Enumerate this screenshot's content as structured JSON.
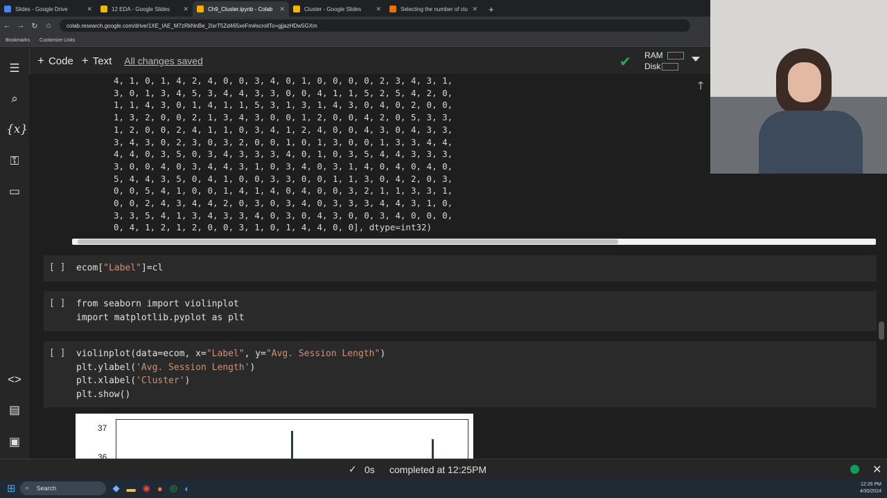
{
  "tabs": [
    {
      "title": "Slides - Google Drive",
      "color": "#4285f4"
    },
    {
      "title": "12 EDA - Google Slides",
      "color": "#f4b400"
    },
    {
      "title": "Ch9_Cluster.ipynb - Colab",
      "color": "#f9ab00"
    },
    {
      "title": "Cluster - Google Slides",
      "color": "#f4b400"
    },
    {
      "title": "Selecting the number of cluste...",
      "color": "#e8710a"
    }
  ],
  "address": {
    "url": "colab.research.google.com/drive/1XE_IAE_M7zRkNnBe_2isrT5Zd465xeFm#scrollTo=gjjazHDw5GXm"
  },
  "bookmarks": {
    "items": [
      "Bookmarks",
      "Customize Links"
    ]
  },
  "toolbar": {
    "code_label": "Code",
    "text_label": "Text",
    "status": "All changes saved",
    "ram_label": "RAM",
    "disk_label": "Disk"
  },
  "output_text": "4, 1, 0, 1, 4, 2, 4, 0, 0, 3, 4, 0, 1, 0, 0, 0, 0, 2, 3, 4, 3, 1,\n3, 0, 1, 3, 4, 5, 3, 4, 4, 3, 3, 0, 0, 4, 1, 1, 5, 2, 5, 4, 2, 0,\n1, 1, 4, 3, 0, 1, 4, 1, 1, 5, 3, 1, 3, 1, 4, 3, 0, 4, 0, 2, 0, 0,\n1, 3, 2, 0, 0, 2, 1, 3, 4, 3, 0, 0, 1, 2, 0, 0, 4, 2, 0, 5, 3, 3,\n1, 2, 0, 0, 2, 4, 1, 1, 0, 3, 4, 1, 2, 4, 0, 0, 4, 3, 0, 4, 3, 3,\n3, 4, 3, 0, 2, 3, 0, 3, 2, 0, 0, 1, 0, 1, 3, 0, 0, 1, 3, 3, 4, 4,\n4, 4, 0, 3, 5, 0, 3, 4, 3, 3, 3, 4, 0, 1, 0, 3, 5, 4, 4, 3, 3, 3,\n3, 0, 0, 4, 0, 3, 4, 4, 3, 1, 0, 3, 4, 0, 3, 1, 4, 0, 4, 0, 4, 0,\n5, 4, 4, 3, 5, 0, 4, 1, 0, 0, 3, 3, 0, 0, 1, 1, 3, 0, 4, 2, 0, 3,\n0, 0, 5, 4, 1, 0, 0, 1, 4, 1, 4, 0, 4, 0, 0, 3, 2, 1, 1, 3, 3, 1,\n0, 0, 2, 4, 3, 4, 4, 2, 0, 3, 0, 3, 4, 0, 3, 3, 3, 4, 4, 3, 1, 0,\n3, 3, 5, 4, 1, 3, 4, 3, 3, 4, 0, 3, 0, 4, 3, 0, 0, 3, 4, 0, 0, 0,\n0, 4, 1, 2, 1, 2, 0, 0, 3, 1, 0, 1, 4, 4, 0, 0], dtype=int32)",
  "cells": [
    {
      "run": "[ ]",
      "code": "ecom[\"Label\"]=cl"
    },
    {
      "run": "[ ]",
      "code": "from seaborn import violinplot\nimport matplotlib.pyplot as plt"
    },
    {
      "run": "[ ]",
      "code": "violinplot(data=ecom, x=\"Label\", y=\"Avg. Session Length\")\nplt.ylabel('Avg. Session Length')\nplt.xlabel('Cluster')\nplt.show()"
    }
  ],
  "plot": {
    "ticks": [
      "37",
      "36"
    ]
  },
  "statusbar": {
    "time": "0s",
    "completed": "completed at 12:25PM"
  },
  "taskbar": {
    "search": "Search",
    "time": "12:26 PM",
    "date": "4/30/2024"
  }
}
